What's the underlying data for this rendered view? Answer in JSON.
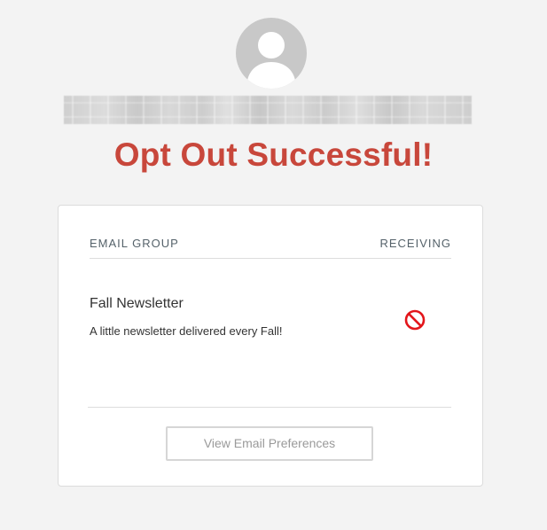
{
  "header": {
    "avatar_icon": "user-silhouette-icon",
    "title": "Opt Out Successful!",
    "title_color": "#c8473b"
  },
  "card": {
    "columns": {
      "left": "EMAIL GROUP",
      "right": "RECEIVING"
    },
    "rows": [
      {
        "name": "Fall Newsletter",
        "description": "A little newsletter delivered every Fall!",
        "receiving_icon": "not-allowed-icon",
        "receiving_color": "#e3161b"
      }
    ],
    "button_label": "View Email Preferences"
  }
}
